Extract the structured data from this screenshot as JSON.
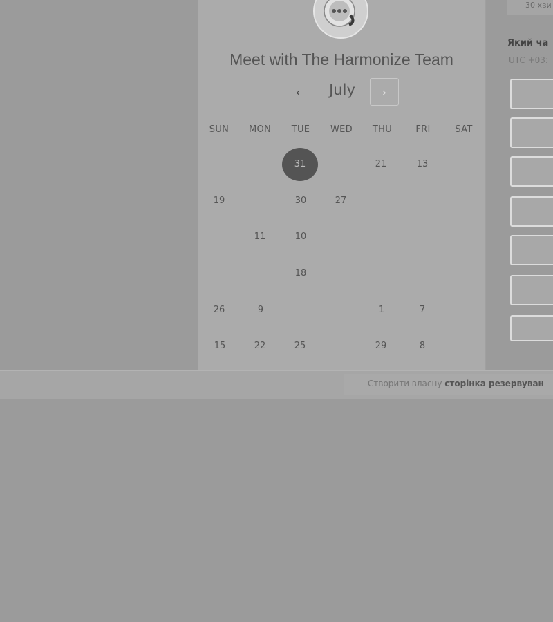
{
  "header": {
    "title": "Meet with The Harmonize Team"
  },
  "calendar": {
    "month": "July",
    "prev_icon": "chevron-left-icon",
    "next_icon": "chevron-right-icon",
    "prev_glyph": "‹",
    "next_glyph": "›",
    "weekdays": [
      "SUN",
      "MON",
      "TUE",
      "WED",
      "THU",
      "FRI",
      "SAT"
    ],
    "days": [
      "31",
      "21",
      "13",
      "19",
      "30",
      "27",
      "11",
      "10",
      "18",
      "26",
      "9",
      "1",
      "7",
      "15",
      "22",
      "25",
      "29",
      "8"
    ],
    "selected_day": "31"
  },
  "sidebar": {
    "duration": "30 хви",
    "tz_label": "Який ча",
    "tz_value": "UTC +03:"
  },
  "footer": {
    "text_prefix": "Створити власну",
    "text_bold": "сторінка резервуван"
  },
  "colors": {
    "background": "#9b9b9b",
    "panel": "#ababab",
    "selected": "#545454"
  }
}
